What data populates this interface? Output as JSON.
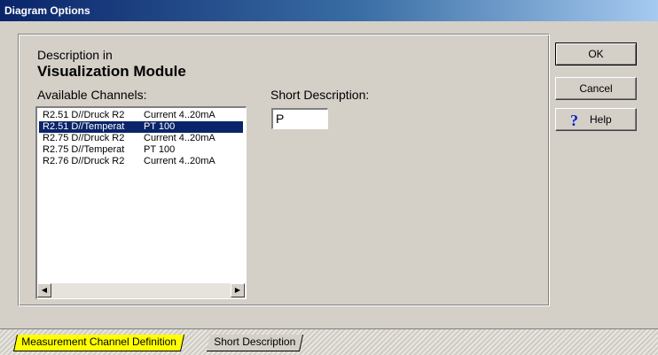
{
  "window": {
    "title": "Diagram Options"
  },
  "panel": {
    "description_in": "Description in",
    "module_name": "Visualization Module",
    "available_channels_label": "Available Channels:",
    "short_description_label": "Short Description:"
  },
  "channels": [
    {
      "id": "R2.51 D//Druck R2",
      "type": "Current 4..20mA",
      "selected": false
    },
    {
      "id": "R2.51 D//Temperat",
      "type": "PT 100",
      "selected": true
    },
    {
      "id": "R2.75 D//Druck R2",
      "type": "Current 4..20mA",
      "selected": false
    },
    {
      "id": "R2.75 D//Temperat",
      "type": "PT 100",
      "selected": false
    },
    {
      "id": "R2.76 D//Druck R2",
      "type": "Current 4..20mA",
      "selected": false
    }
  ],
  "short_description": {
    "value": "P"
  },
  "buttons": {
    "ok": "OK",
    "cancel": "Cancel",
    "help": "Help"
  },
  "icons": {
    "help": "help-question-icon",
    "scroll_left": "arrow-left-icon",
    "scroll_right": "arrow-right-icon"
  },
  "tabs": [
    {
      "label": "Measurement Channel Definition",
      "active": true
    },
    {
      "label": "Short Description",
      "active": false
    }
  ],
  "colors": {
    "title_bar": "#0a246a",
    "selection": "#0a246a",
    "active_tab": "#ffff00",
    "face": "#d4d0c8"
  }
}
